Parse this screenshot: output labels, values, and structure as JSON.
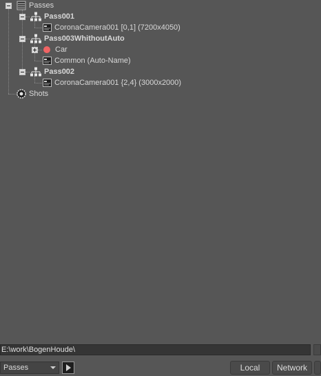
{
  "tree": {
    "root_label": "Passes",
    "passes": [
      {
        "label": "Pass001",
        "children": [
          {
            "label": "CoronaCamera001 [0,1] (7200x4050)"
          }
        ]
      },
      {
        "label": "Pass003WhithoutAuto",
        "children": [
          {
            "label": "Car"
          },
          {
            "label": "Common (Auto-Name)"
          }
        ]
      },
      {
        "label": "Pass002",
        "children": [
          {
            "label": "CoronaCamera001 {2,4} (3000x2000)"
          }
        ]
      }
    ],
    "shots_label": "Shots"
  },
  "bottom": {
    "path_value": "E:\\work\\BogenHoude\\",
    "mode_selected": "Passes",
    "local_label": "Local",
    "network_label": "Network"
  },
  "colors": {
    "background": "#565656",
    "car_dot": "#f06464"
  }
}
